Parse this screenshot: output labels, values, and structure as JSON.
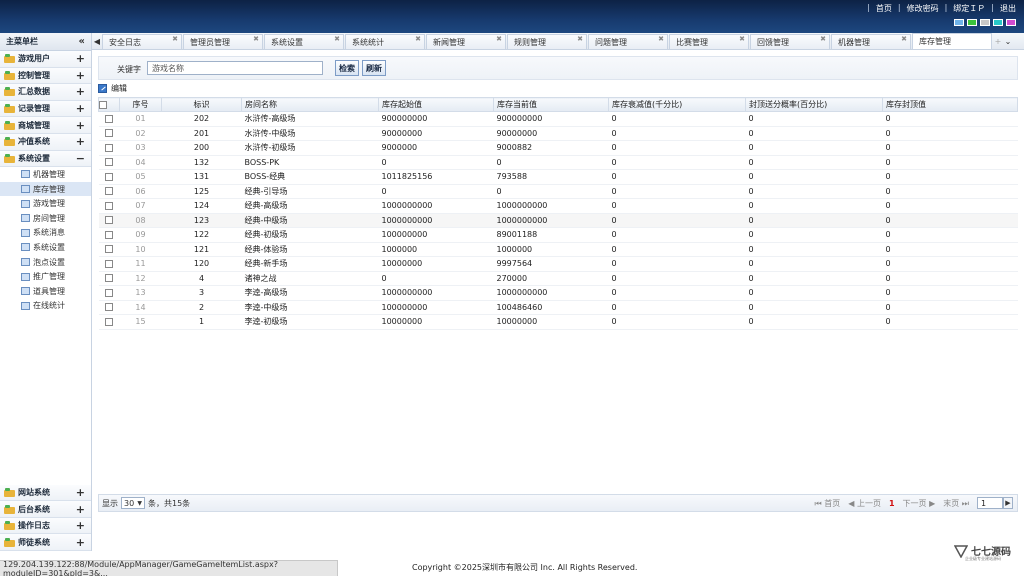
{
  "header": {
    "links": [
      "首页",
      "修改密码",
      "绑定ＩＰ",
      "退出"
    ],
    "swatch_colors": [
      "#6fb3e8",
      "#3cc43c",
      "#c8c8c8",
      "#28c8c8",
      "#d04bd0"
    ]
  },
  "sidebar": {
    "title": "主菜单栏",
    "groups_top": [
      {
        "label": "游戏用户",
        "toggle": "+"
      },
      {
        "label": "控制管理",
        "toggle": "+"
      },
      {
        "label": "汇总数据",
        "toggle": "+"
      },
      {
        "label": "记录管理",
        "toggle": "+"
      },
      {
        "label": "商城管理",
        "toggle": "+"
      },
      {
        "label": "冲值系统",
        "toggle": "+"
      },
      {
        "label": "系统设置",
        "toggle": "−"
      }
    ],
    "sub_items": [
      "机器管理",
      "库存管理",
      "游戏管理",
      "房间管理",
      "系统消息",
      "系统设置",
      "泡点设置",
      "推广管理",
      "道具管理",
      "在线统计"
    ],
    "active_sub": "库存管理",
    "groups_bottom": [
      {
        "label": "网站系统",
        "toggle": "+"
      },
      {
        "label": "后台系统",
        "toggle": "+"
      },
      {
        "label": "操作日志",
        "toggle": "+"
      },
      {
        "label": "师徒系统",
        "toggle": "+"
      }
    ]
  },
  "tabs": [
    "安全日志",
    "管理员管理",
    "系统设置",
    "系统统计",
    "新闻管理",
    "规则管理",
    "问题管理",
    "比赛管理",
    "回馈管理",
    "机器管理",
    "库存管理"
  ],
  "active_tab": "库存管理",
  "search": {
    "label": "关键字",
    "placeholder": "游戏名称",
    "search_button": "检索",
    "refresh_button": "刷新"
  },
  "toolbar": {
    "edit_label": "编辑"
  },
  "table": {
    "columns": [
      "序号",
      "标识",
      "房间名称",
      "库存起始值",
      "库存当前值",
      "库存衰减值(千分比)",
      "封顶送分概率(百分比)",
      "库存封顶值"
    ],
    "rows": [
      [
        "01",
        "202",
        "水浒传-高级场",
        "900000000",
        "900000000",
        "0",
        "0",
        "0"
      ],
      [
        "02",
        "201",
        "水浒传-中级场",
        "90000000",
        "90000000",
        "0",
        "0",
        "0"
      ],
      [
        "03",
        "200",
        "水浒传-初级场",
        "9000000",
        "9000882",
        "0",
        "0",
        "0"
      ],
      [
        "04",
        "132",
        "BOSS-PK",
        "0",
        "0",
        "0",
        "0",
        "0"
      ],
      [
        "05",
        "131",
        "BOSS-经典",
        "1011825156",
        "793588",
        "0",
        "0",
        "0"
      ],
      [
        "06",
        "125",
        "经典-引导场",
        "0",
        "0",
        "0",
        "0",
        "0"
      ],
      [
        "07",
        "124",
        "经典-高级场",
        "1000000000",
        "1000000000",
        "0",
        "0",
        "0"
      ],
      [
        "08",
        "123",
        "经典-中级场",
        "1000000000",
        "1000000000",
        "0",
        "0",
        "0"
      ],
      [
        "09",
        "122",
        "经典-初级场",
        "100000000",
        "89001188",
        "0",
        "0",
        "0"
      ],
      [
        "10",
        "121",
        "经典-体验场",
        "1000000",
        "1000000",
        "0",
        "0",
        "0"
      ],
      [
        "11",
        "120",
        "经典-新手场",
        "10000000",
        "9997564",
        "0",
        "0",
        "0"
      ],
      [
        "12",
        "4",
        "诸神之战",
        "0",
        "270000",
        "0",
        "0",
        "0"
      ],
      [
        "13",
        "3",
        "李逵-高级场",
        "1000000000",
        "1000000000",
        "0",
        "0",
        "0"
      ],
      [
        "14",
        "2",
        "李逵-中级场",
        "100000000",
        "100486460",
        "0",
        "0",
        "0"
      ],
      [
        "15",
        "1",
        "李逵-初级场",
        "10000000",
        "10000000",
        "0",
        "0",
        "0"
      ]
    ],
    "highlight_row": 7
  },
  "pager": {
    "show_label": "显示",
    "page_size": "30",
    "summary": "条，共15条",
    "first": "首页",
    "prev": "上一页",
    "current": "1",
    "next": "下一页",
    "last": "末页",
    "page_input": "1"
  },
  "status_url": "129.204.139.122:88/Module/AppManager/GameGameItemList.aspx?moduleID=301&pId=3&...",
  "copyright": "Copyright ©2025深圳市有限公司 Inc. All Rights Reserved.",
  "watermark": {
    "text": "七七源码",
    "sub": "企业级专业建站源码"
  }
}
